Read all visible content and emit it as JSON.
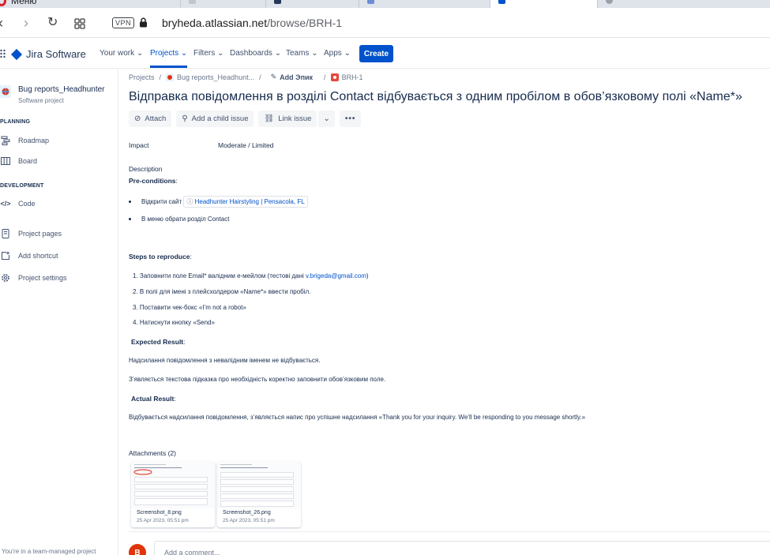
{
  "browser": {
    "menu_label": "Меню",
    "vpn_badge": "VPN",
    "url_domain": "bryheda.atlassian.net",
    "url_path": "/browse/BRH-1"
  },
  "topnav": {
    "product": "Jira Software",
    "items": [
      "Your work",
      "Projects",
      "Filters",
      "Dashboards",
      "Teams",
      "Apps"
    ],
    "active_item": "Projects",
    "create_label": "Create"
  },
  "sidebar": {
    "project_name": "Bug reports_Headhunter",
    "project_type": "Software project",
    "planning_heading": "PLANNING",
    "roadmap": "Roadmap",
    "board": "Board",
    "development_heading": "DEVELOPMENT",
    "code": "Code",
    "project_pages": "Project pages",
    "add_shortcut": "Add shortcut",
    "project_settings": "Project settings",
    "footer": "You're in a team-managed project"
  },
  "breadcrumb": {
    "projects": "Projects",
    "project": "Bug reports_Headhunt...",
    "epic": "Add Эпик",
    "issue_key": "BRH-1"
  },
  "issue": {
    "title": "Відправка повідомлення в розділі Contact відбувається з одним пробілом в обов’язковому полі «Name*»",
    "actions": {
      "attach": "Attach",
      "child": "Add a child issue",
      "link": "Link issue"
    },
    "impact_label": "Impact",
    "impact_value": "Moderate / Limited",
    "description_label": "Description",
    "preconditions_label": "Pre-conditions",
    "pre_item1_text": "Відкрити сайт",
    "pre_item1_link": "Headhunter Hairstyling | Pensacola, FL",
    "pre_item2": "В меню обрати розділ Contact",
    "steps_label": "Steps to reproduce",
    "step1_text": "1. Заповнити поле Email* валідним е-мейлом (тестові дані ",
    "step1_email": "v.brigeda@gmail.com",
    "step1_end": ")",
    "step2": "2. В полі для імені з плейсхолдером «Name*» ввести пробіл.",
    "step3": "3. Поставити чек-бокс «I’m not a robot»",
    "step4": "4. Натиснути кнопку «Send»",
    "expected_label": "Expected Result",
    "expected_1": "Надсилання повідомлення з невалідним іменем не відбувається.",
    "expected_2": "З’являється текстова підказка про необхідність коректно заповнити обов’язковим поле.",
    "actual_label": "Actual Result",
    "actual_1": "Відбувається надсилання повідомлення, з’являється напис про успішне надсилання «Thank you for your inquiry. We’ll be responding to you message shortly.»",
    "attachments_label": "Attachments (2)",
    "attachments": [
      {
        "name": "Screenshot_8.png",
        "date": "25 Apr 2023, 05:51 pm"
      },
      {
        "name": "Screenshot_26.png",
        "date": "25 Apr 2023, 05:51 pm"
      }
    ],
    "comment_avatar": "В",
    "comment_placeholder": "Add a comment..."
  },
  "colors": {
    "brand": "#0052cc",
    "avatar": "#de350b"
  }
}
